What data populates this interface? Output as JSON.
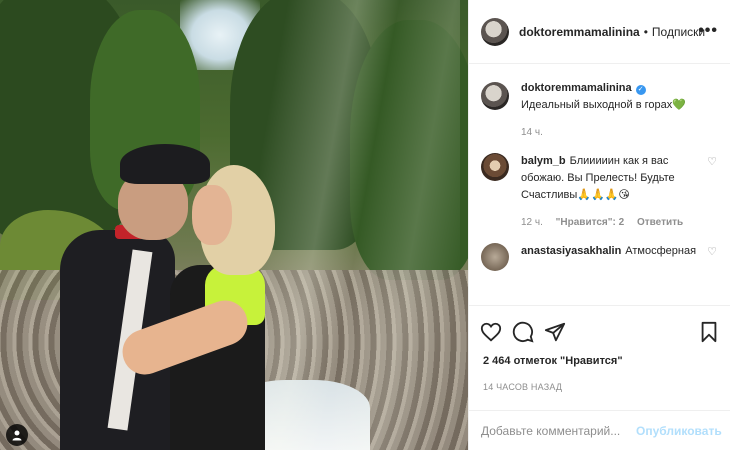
{
  "post": {
    "username": "doktoremmamalinina",
    "separator": "•",
    "follow_label": "Подписки",
    "more_icon": "more-horizontal-icon"
  },
  "caption": {
    "username": "doktoremmamalinina",
    "text": "Идеальный выходной в горах💚",
    "time": "14 ч."
  },
  "comments": [
    {
      "username": "balym_b",
      "text": "Блииииин как я вас обожаю. Вы Прелесть! Будьте Счастливы🙏🙏🙏😘",
      "time": "12 ч.",
      "likes": "\"Нравится\": 2",
      "reply": "Ответить"
    },
    {
      "username": "anastasiyasakhalin",
      "text": "Атмосферная"
    }
  ],
  "actions": {
    "like_icon": "heart-icon",
    "comment_icon": "comment-icon",
    "share_icon": "send-icon",
    "save_icon": "bookmark-icon"
  },
  "likes_text": "2 464 отметок \"Нравится\"",
  "time_ago": "14 ЧАСОВ НАЗАД",
  "add_comment": {
    "placeholder": "Добавьте комментарий...",
    "publish": "Опубликовать"
  },
  "colors": {
    "accent": "#3897f0",
    "publish_disabled": "#b2dffc",
    "muted": "#8e8e8e"
  }
}
